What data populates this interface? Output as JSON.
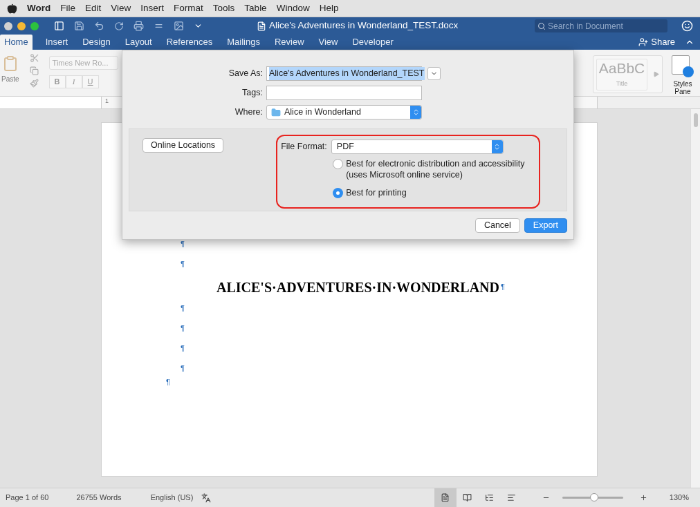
{
  "menu_bar": {
    "app": "Word",
    "items": [
      "File",
      "Edit",
      "View",
      "Insert",
      "Format",
      "Tools",
      "Table",
      "Window",
      "Help"
    ]
  },
  "window": {
    "title": "Alice's Adventures in Wonderland_TEST.docx",
    "search_placeholder": "Search in Document"
  },
  "ribbon_tabs": [
    {
      "label": "Home",
      "selected": true
    },
    {
      "label": "Insert",
      "selected": false
    },
    {
      "label": "Design",
      "selected": false
    },
    {
      "label": "Layout",
      "selected": false
    },
    {
      "label": "References",
      "selected": false
    },
    {
      "label": "Mailings",
      "selected": false
    },
    {
      "label": "Review",
      "selected": false
    },
    {
      "label": "View",
      "selected": false
    },
    {
      "label": "Developer",
      "selected": false
    }
  ],
  "share": "Share",
  "ribbon": {
    "paste": "Paste",
    "font_name": "Times New Ro...",
    "format_buttons": [
      "B",
      "I",
      "U"
    ],
    "style_preview": "AaBbC",
    "style_name": "Title",
    "styles_pane": "Styles Pane"
  },
  "ruler": {
    "mark": "1"
  },
  "document": {
    "lines": [
      {
        "kind": "mark",
        "text": "¶"
      },
      {
        "kind": "mark",
        "text": "¶"
      },
      {
        "kind": "heading",
        "text": "ALICE'S·ADVENTURES·IN·WONDERLAND",
        "mark": "¶"
      },
      {
        "kind": "mark",
        "text": "¶"
      },
      {
        "kind": "mark",
        "text": "¶"
      },
      {
        "kind": "mark",
        "text": "¶"
      },
      {
        "kind": "mark",
        "text": "¶"
      },
      {
        "kind": "end_mark",
        "text": "¶"
      }
    ]
  },
  "dialog": {
    "save_as_label": "Save As:",
    "save_as_value": "Alice's Adventures in Wonderland_TEST",
    "tags_label": "Tags:",
    "where_label": "Where:",
    "where_value": "Alice in Wonderland",
    "online_locations": "Online Locations",
    "file_format_label": "File Format:",
    "file_format_value": "PDF",
    "options": [
      {
        "label": "Best for electronic distribution and accessibility",
        "note": "(uses Microsoft online service)",
        "selected": false
      },
      {
        "label": "Best for printing",
        "selected": true
      }
    ],
    "buttons": [
      {
        "label": "Cancel",
        "kind": "secondary"
      },
      {
        "label": "Export",
        "kind": "primary"
      }
    ]
  },
  "status_bar": {
    "page": "Page 1 of 60",
    "words": "26755 Words",
    "language": "English (US)",
    "view_modes": [
      {
        "selected": true
      },
      {
        "selected": false
      },
      {
        "selected": false
      },
      {
        "selected": false
      }
    ],
    "zoom": {
      "level": 0.53,
      "reading": "130%"
    }
  }
}
